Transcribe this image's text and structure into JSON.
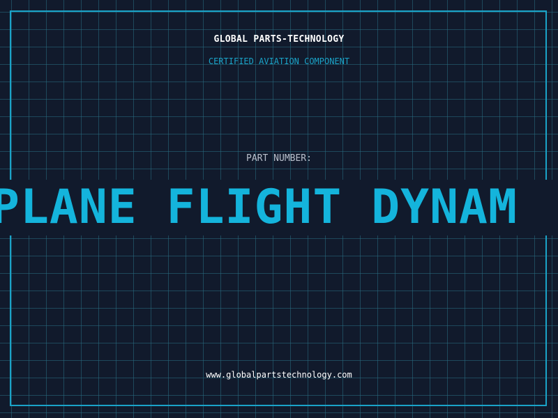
{
  "header": {
    "company_name": "GLOBAL PARTS-TECHNOLOGY",
    "subtitle": "CERTIFIED AVIATION COMPONENT"
  },
  "part": {
    "label": "PART NUMBER:",
    "value": "PLANE FLIGHT DYNAM"
  },
  "footer": {
    "website": "www.globalpartstechnology.com"
  },
  "colors": {
    "background": "#111a2c",
    "accent": "#1aa3c8",
    "part_number": "#14b4dc",
    "grid": "#286e82"
  }
}
